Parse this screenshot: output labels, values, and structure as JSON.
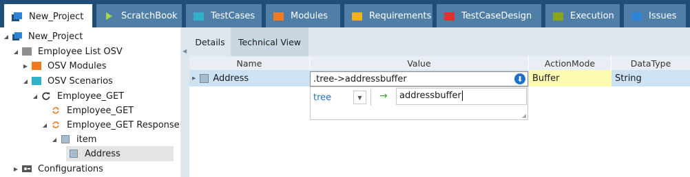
{
  "tabs": [
    {
      "label": "New_Project",
      "icon": "project-icon",
      "color": "#1f4e79",
      "active": true,
      "close": "×"
    },
    {
      "label": "ScratchBook",
      "icon": "play-icon",
      "color": "#a7d64a"
    },
    {
      "label": "TestCases",
      "icon": "folder-icon",
      "color": "#2fb2c9"
    },
    {
      "label": "Modules",
      "icon": "folder-icon",
      "color": "#f07a20"
    },
    {
      "label": "Requirements",
      "icon": "folder-icon",
      "color": "#f4b219"
    },
    {
      "label": "TestCaseDesign",
      "icon": "folder-icon",
      "color": "#e03030"
    },
    {
      "label": "Execution",
      "icon": "folder-icon",
      "color": "#8aa41b"
    },
    {
      "label": "Issues",
      "icon": "folder-icon",
      "color": "#2e83d8"
    }
  ],
  "tree": [
    {
      "label": "New_Project",
      "icon": "project-icon",
      "expanded": true
    },
    {
      "label": "Employee List OSV",
      "icon": "folder-icon",
      "color": "#8e8e8e",
      "expanded": true
    },
    {
      "label": "OSV Modules",
      "icon": "folder-icon",
      "color": "#f07a20",
      "expanded": false
    },
    {
      "label": "OSV Scenarios",
      "icon": "folder-icon",
      "color": "#2fb2c9",
      "expanded": true
    },
    {
      "label": "Employee_GET",
      "icon": "refresh-icon",
      "expanded": true
    },
    {
      "label": "Employee_GET",
      "icon": "cycle-icon",
      "color": "#f07a20"
    },
    {
      "label": "Employee_GET Response",
      "icon": "cycle-icon",
      "color": "#f07a20",
      "expanded": true
    },
    {
      "label": "item",
      "icon": "square-icon",
      "expanded": true
    },
    {
      "label": "Address",
      "icon": "square-icon",
      "selected": true
    },
    {
      "label": "Configurations",
      "icon": "config-icon",
      "expanded": false
    }
  ],
  "subtabs": {
    "details": "Details",
    "technical": "Technical View"
  },
  "columns": {
    "name": "Name",
    "value": "Value",
    "actionmode": "ActionMode",
    "datatype": "DataType"
  },
  "row": {
    "name": "Address",
    "value": ".tree->addressbuffer",
    "actionmode": "Buffer",
    "datatype": "String"
  },
  "editor": {
    "source": "tree",
    "target": "addressbuffer",
    "arrow": "→"
  }
}
